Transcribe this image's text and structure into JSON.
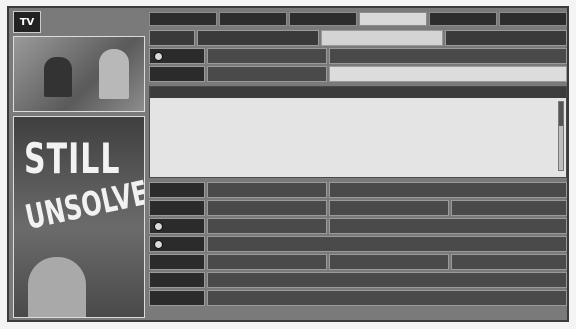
{
  "app": {
    "logo": "TV"
  },
  "nav": {
    "tabs": [
      "",
      "",
      "",
      "",
      "",
      ""
    ],
    "active_index": 3
  },
  "grid": {
    "times": [
      "",
      "",
      "",
      ""
    ],
    "rows_top": [
      {
        "channel": "",
        "programs": [
          "",
          ""
        ]
      },
      {
        "channel": "",
        "programs": [
          "",
          ""
        ]
      }
    ],
    "detail": {
      "header_left": "",
      "header_chip": "",
      "header_right": "",
      "text": ""
    },
    "rows_bottom": [
      {
        "channel": "",
        "programs": [
          "",
          ""
        ]
      },
      {
        "channel": "",
        "programs": [
          "",
          "",
          ""
        ]
      },
      {
        "channel": "",
        "programs": [
          "",
          ""
        ]
      },
      {
        "channel": "",
        "programs": [
          ""
        ]
      },
      {
        "channel": "",
        "programs": [
          "",
          "",
          ""
        ]
      },
      {
        "channel": "",
        "programs": [
          ""
        ]
      },
      {
        "channel": "",
        "programs": [
          ""
        ]
      }
    ]
  },
  "poster": {
    "line1": "STILL",
    "line2": "UNSOLVED",
    "name": "",
    "time": "",
    "rating": "",
    "credit": ""
  }
}
